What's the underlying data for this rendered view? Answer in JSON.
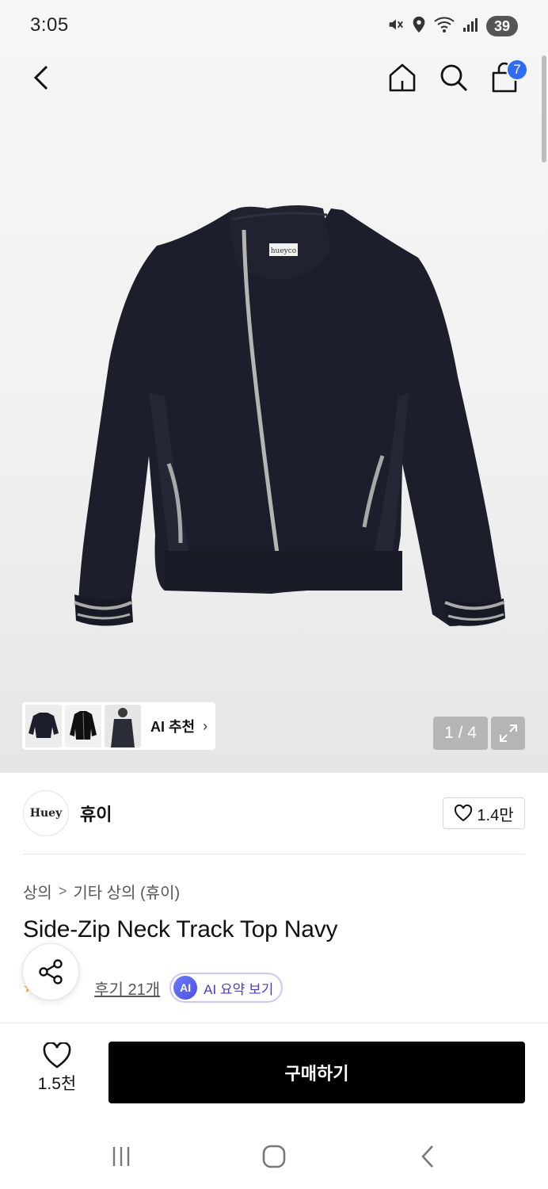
{
  "status_bar": {
    "time": "3:05",
    "battery": "39",
    "icons": [
      "mute-icon",
      "location-icon",
      "wifi-icon",
      "signal-icon",
      "battery-icon"
    ]
  },
  "header": {
    "icons": [
      "back-icon",
      "home-icon",
      "search-icon",
      "shopping-bag-icon"
    ],
    "cart_count": "7"
  },
  "gallery": {
    "page_counter": "1 / 4",
    "ai_recommend_label": "AI 추천",
    "ai_recommend_chevron": "›",
    "tag_text": "hueyco"
  },
  "brand": {
    "logo_text": "Huey",
    "name": "휴이",
    "like_count": "1.4만"
  },
  "breadcrumb": {
    "items": [
      "상의",
      "기타 상의 (휴이)"
    ],
    "separator": ">"
  },
  "product": {
    "title": "Side-Zip Neck Track Top Navy",
    "review_link": "후기 21개",
    "ai_badge": "AI",
    "ai_summary_label": "AI 요약 보기"
  },
  "bottom_bar": {
    "wish_count": "1.5천",
    "buy_label": "구매하기"
  },
  "colors": {
    "buy_button": "#000000",
    "cart_badge": "#2f6bf5",
    "ai_accent": "#4b3bd1",
    "jacket": "#1c1f2b"
  }
}
